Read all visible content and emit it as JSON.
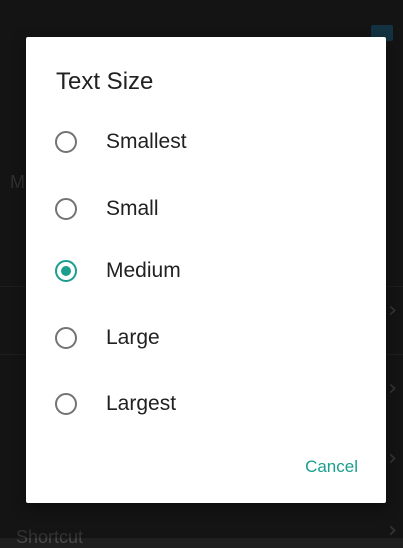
{
  "background": {
    "partial_label_left": "M",
    "partial_label_bottom": "Shortcut"
  },
  "dialog": {
    "title": "Text Size",
    "options": [
      {
        "label": "Smallest",
        "checked": false
      },
      {
        "label": "Small",
        "checked": false
      },
      {
        "label": "Medium",
        "checked": true
      },
      {
        "label": "Large",
        "checked": false
      },
      {
        "label": "Largest",
        "checked": false
      }
    ],
    "cancel_label": "Cancel"
  },
  "colors": {
    "accent": "#1a9e8d",
    "title_text": "#212121",
    "radio_unchecked": "#737373",
    "scrim": "#202020"
  }
}
